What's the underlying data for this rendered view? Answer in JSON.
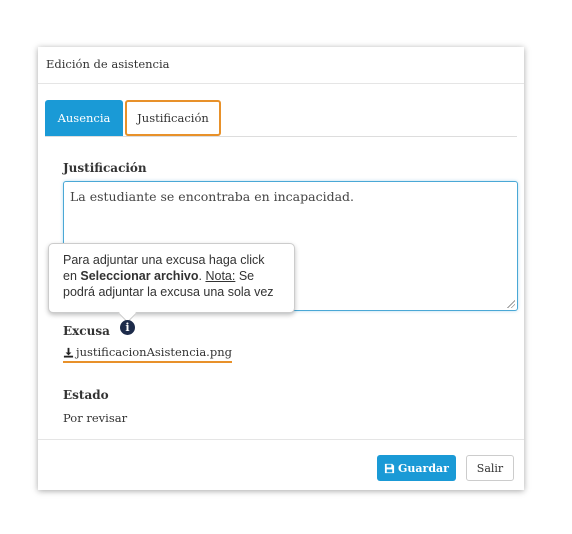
{
  "modal": {
    "title": "Edición de asistencia",
    "tabs": [
      {
        "label": "Ausencia",
        "active": true
      },
      {
        "label": "Justificación",
        "active": false
      }
    ],
    "justificacion": {
      "label": "Justificación",
      "value": "La estudiante se encontraba en incapacidad."
    },
    "tooltip": {
      "text_1": "Para adjuntar una excusa haga click en ",
      "bold": "Seleccionar archivo",
      "text_2": ". ",
      "note_label": "Nota:",
      "text_3": " Se podrá adjuntar la excusa una sola vez"
    },
    "excusa": {
      "label": "Excusa",
      "file_name": "justificacionAsistencia.png",
      "icons": [
        "info-icon",
        "download-icon"
      ]
    },
    "estado": {
      "label": "Estado",
      "value": "Por revisar"
    },
    "buttons": {
      "save": "Guardar",
      "exit": "Salir"
    },
    "colors": {
      "primary": "#1a9ad6",
      "highlight": "#e8912a"
    }
  }
}
